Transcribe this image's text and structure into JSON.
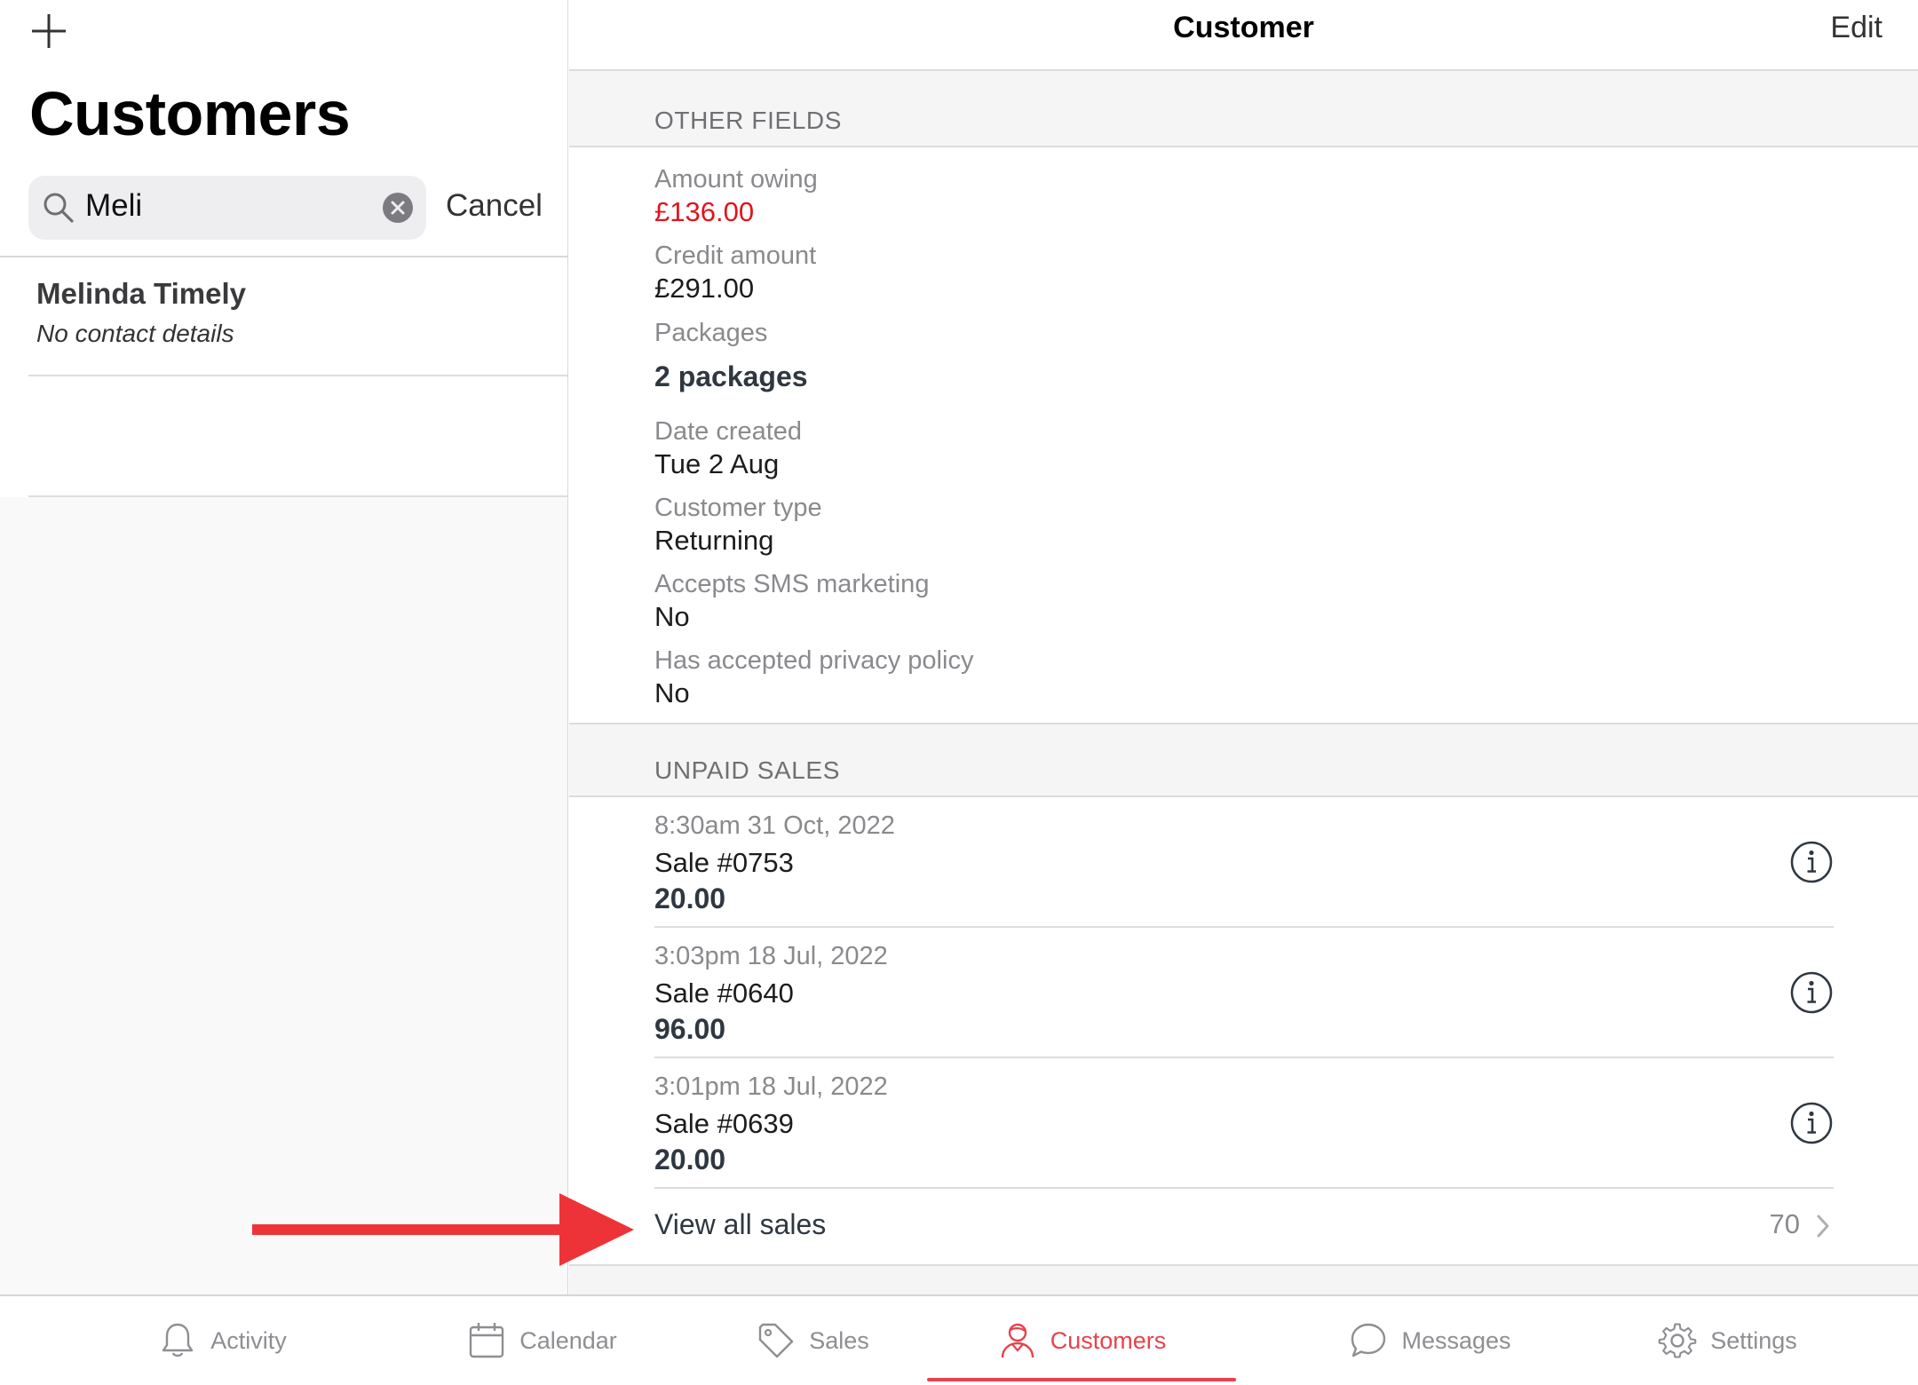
{
  "left": {
    "title": "Customers",
    "search": {
      "value": "Meli",
      "cancel_label": "Cancel"
    },
    "results": [
      {
        "name": "Melinda Timely",
        "subtitle": "No contact details"
      }
    ]
  },
  "right": {
    "nav": {
      "title": "Customer",
      "edit_label": "Edit"
    },
    "other_fields": {
      "header": "OTHER FIELDS",
      "fields": [
        {
          "label": "Amount owing",
          "value": "£136.00"
        },
        {
          "label": "Credit amount",
          "value": "£291.00"
        },
        {
          "label": "Packages",
          "value": "2 packages"
        },
        {
          "label": "Date created",
          "value": "Tue 2 Aug"
        },
        {
          "label": "Customer type",
          "value": "Returning"
        },
        {
          "label": "Accepts SMS marketing",
          "value": "No"
        },
        {
          "label": "Has accepted privacy policy",
          "value": "No"
        }
      ]
    },
    "unpaid_sales": {
      "header": "UNPAID SALES",
      "sales": [
        {
          "date": "8:30am 31 Oct, 2022",
          "number": "Sale #0753",
          "amount": "20.00"
        },
        {
          "date": "3:03pm 18 Jul, 2022",
          "number": "Sale #0640",
          "amount": "96.00"
        },
        {
          "date": "3:01pm 18 Jul, 2022",
          "number": "Sale #0639",
          "amount": "20.00"
        }
      ],
      "view_all": {
        "label": "View all sales",
        "count": "70"
      }
    }
  },
  "tabs": [
    {
      "label": "Activity",
      "icon": "bell-icon"
    },
    {
      "label": "Calendar",
      "icon": "calendar-icon"
    },
    {
      "label": "Sales",
      "icon": "tag-icon"
    },
    {
      "label": "Customers",
      "icon": "person-icon",
      "active": true
    },
    {
      "label": "Messages",
      "icon": "chat-bubble-icon"
    },
    {
      "label": "Settings",
      "icon": "gear-icon"
    }
  ],
  "colors": {
    "accent": "#e8424b",
    "owing": "#e0141e",
    "annotation_arrow": "#ee3338"
  }
}
